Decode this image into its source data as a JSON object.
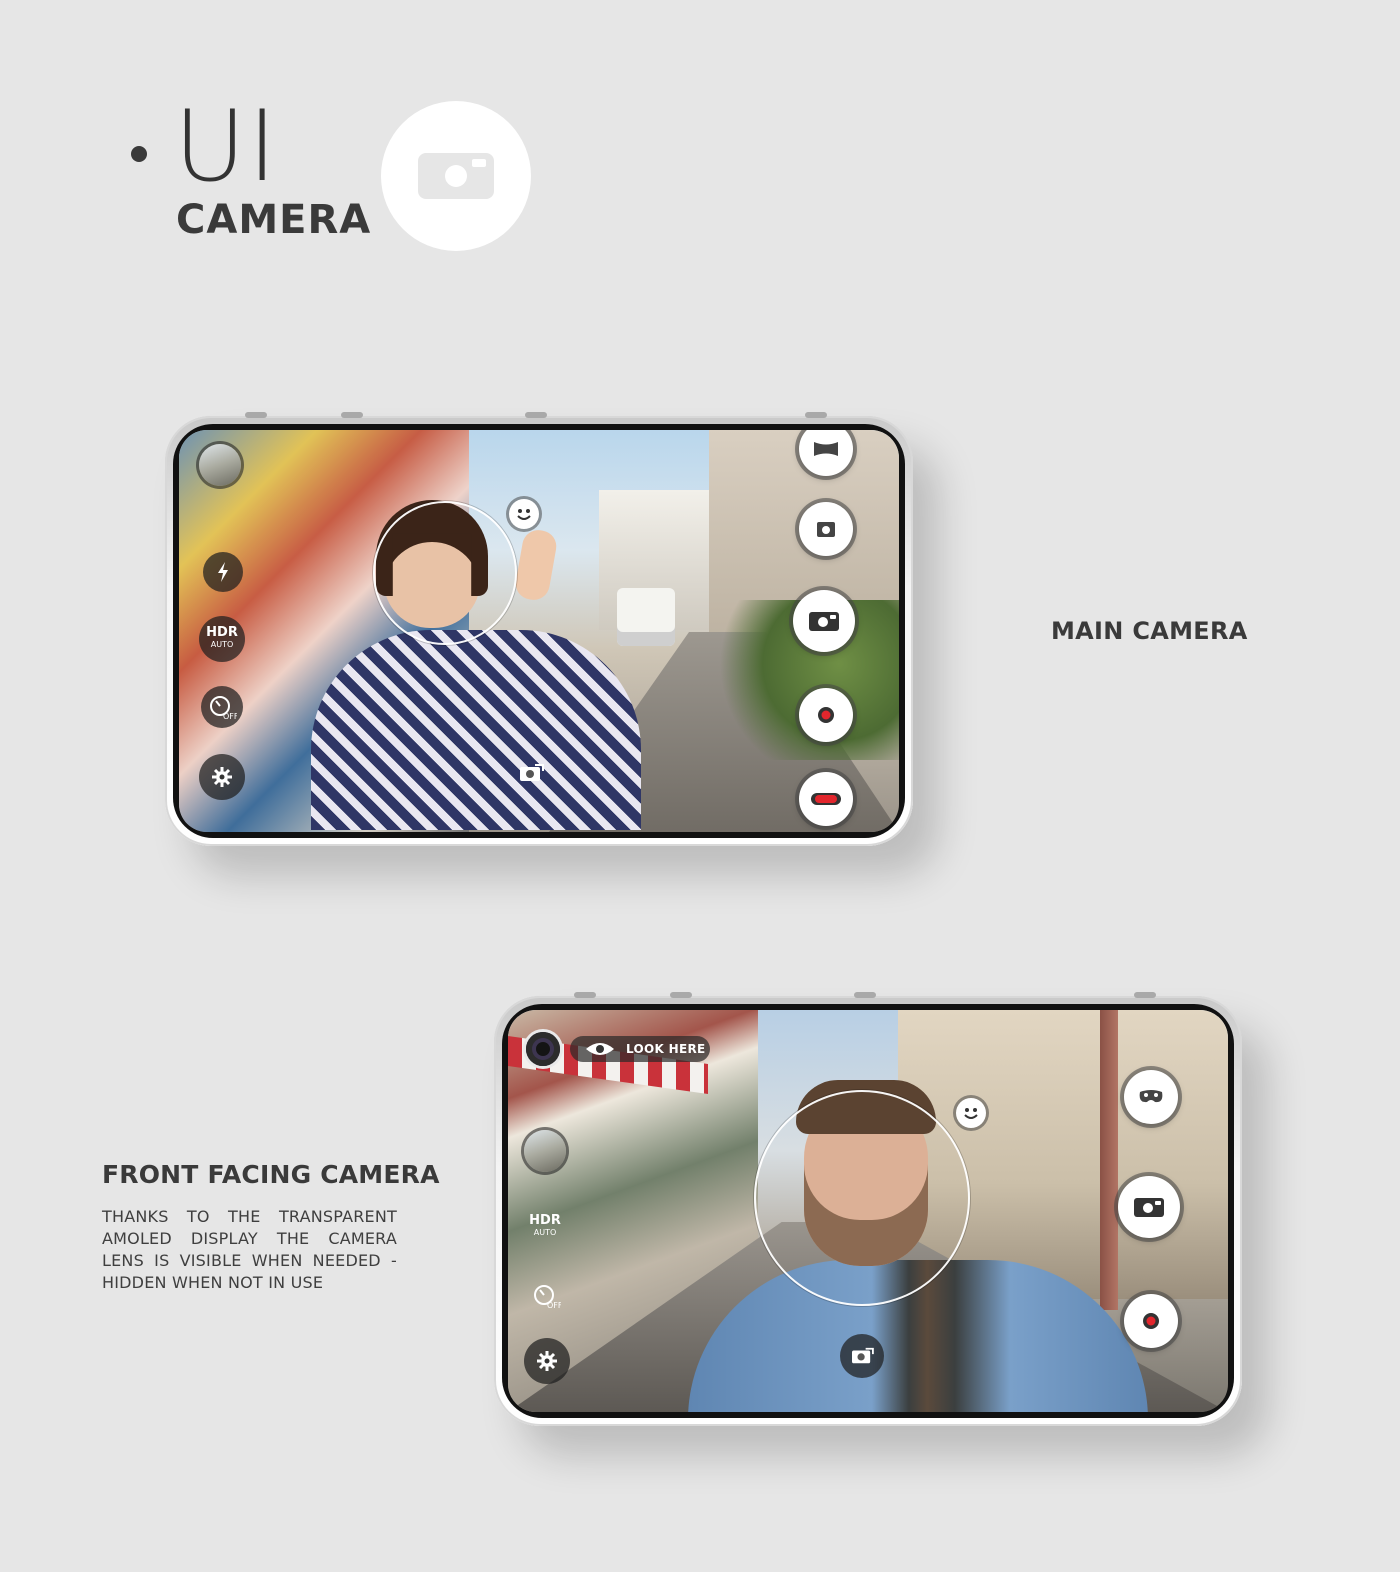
{
  "header": {
    "title": "UI",
    "subtitle": "CAMERA",
    "badge_icon": "camera-icon"
  },
  "main_camera": {
    "label": "MAIN CAMERA",
    "controls": {
      "left": [
        "gallery-thumbnail",
        "flash-icon",
        "hdr-auto",
        "timer-off-icon",
        "settings-icon"
      ],
      "right": [
        "panorama-icon",
        "photo-mode-icon",
        "shutter-camera-icon",
        "video-record-icon",
        "record-toggle-icon"
      ],
      "switch_camera": "switch-camera-icon",
      "face_detect": "smiley-icon"
    },
    "hdr_label": "HDR",
    "hdr_sub": "AUTO",
    "timer_sub": "OFF"
  },
  "front_camera": {
    "label": "FRONT FACING CAMERA",
    "description": "THANKS TO THE TRANSPARENT AMOLED DISPLAY THE CAMERA LENS IS VISIBLE WHEN NEEDED - HIDDEN WHEN NOT IN USE",
    "look_here": "LOOK HERE",
    "hdr_label": "HDR",
    "hdr_sub": "AUTO",
    "timer_sub": "OFF",
    "controls": {
      "left": [
        "front-lens",
        "gallery-thumbnail",
        "hdr-auto",
        "timer-off-icon",
        "settings-icon"
      ],
      "right": [
        "mask-effect-icon",
        "shutter-camera-icon",
        "video-record-icon"
      ],
      "switch_camera": "switch-camera-icon",
      "face_detect": "smiley-icon"
    }
  },
  "colors": {
    "background": "#e6e6e6",
    "text": "#3a3a3a",
    "record_red": "#e3262d"
  }
}
